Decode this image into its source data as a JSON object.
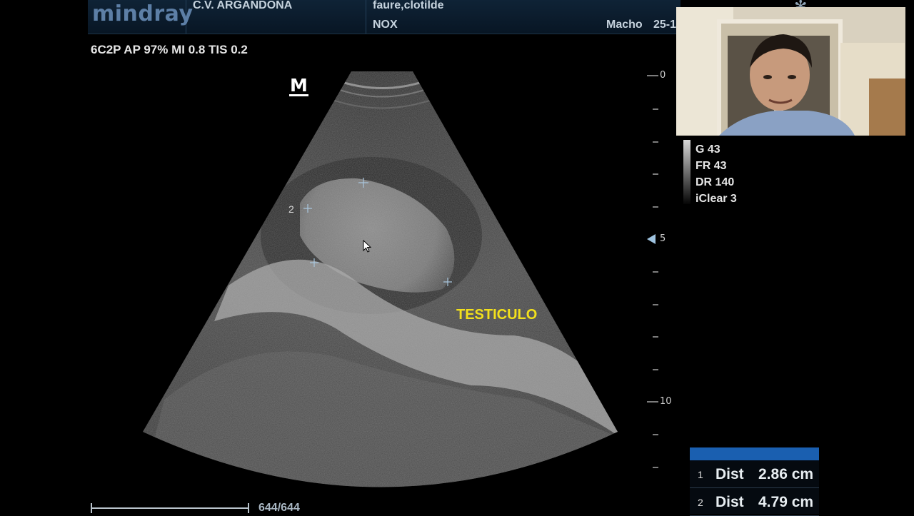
{
  "header": {
    "logo": "mindray",
    "hospital": "C.V. ARGANDOÑA",
    "patient_name": "faure,clotilde",
    "patient_id": "NOX",
    "sex": "Macho",
    "date_fragment": "25-1"
  },
  "imaging_params": "6C2P  AP 97%  MI 0.8 TIS 0.2",
  "orientation_marker": "M",
  "organ_label": "TESTICULO",
  "caliper_label": "2",
  "depth_scale": {
    "labels": [
      "0",
      "5",
      "10"
    ]
  },
  "processing": [
    "G 43",
    "FR 43",
    "DR 140",
    "iClear 3"
  ],
  "measurements": [
    {
      "index": "1",
      "label": "Dist",
      "value": "2.86 cm"
    },
    {
      "index": "2",
      "label": "Dist",
      "value": "4.79 cm"
    }
  ],
  "cine": {
    "frame": "644/644",
    "progress": 1.0
  },
  "colors": {
    "header_bg": "#0f2336",
    "organ_label": "#f2e01c",
    "measure_header": "#1a5fb0"
  }
}
